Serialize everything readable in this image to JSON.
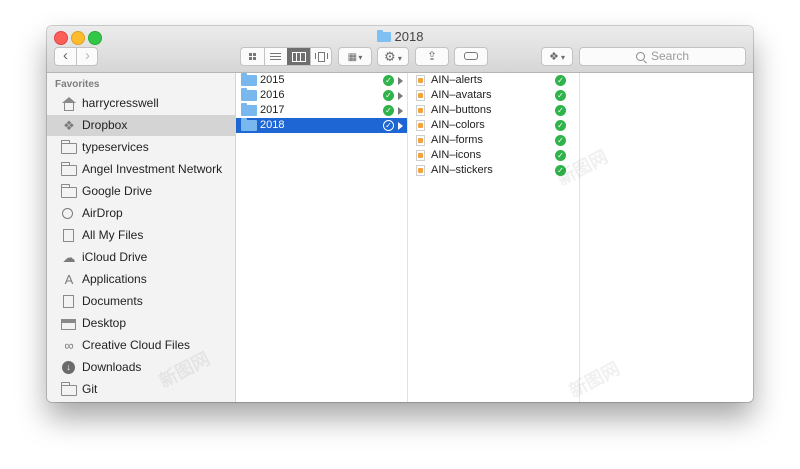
{
  "window": {
    "title": "2018"
  },
  "toolbar": {
    "back_glyph": "‹",
    "forward_glyph": "›",
    "search_placeholder": "Search",
    "view_modes": [
      "icon-view-icon",
      "list-view-icon",
      "column-view-icon",
      "cover-flow-icon"
    ]
  },
  "sidebar": {
    "header": "Favorites",
    "items": [
      {
        "label": "harrycresswell",
        "icon": "house-icon"
      },
      {
        "label": "Dropbox",
        "icon": "dropbox-icon"
      },
      {
        "label": "typeservices",
        "icon": "folder-icon"
      },
      {
        "label": "Angel Investment Network",
        "icon": "folder-icon"
      },
      {
        "label": "Google Drive",
        "icon": "folder-icon"
      },
      {
        "label": "AirDrop",
        "icon": "airdrop-icon"
      },
      {
        "label": "All My Files",
        "icon": "files-icon"
      },
      {
        "label": "iCloud Drive",
        "icon": "cloud-icon"
      },
      {
        "label": "Applications",
        "icon": "applications-icon"
      },
      {
        "label": "Documents",
        "icon": "documents-icon"
      },
      {
        "label": "Desktop",
        "icon": "desktop-icon"
      },
      {
        "label": "Creative Cloud Files",
        "icon": "creative-cloud-icon"
      },
      {
        "label": "Downloads",
        "icon": "download-icon"
      },
      {
        "label": "Git",
        "icon": "folder-icon"
      }
    ],
    "selected_index": 1
  },
  "columns": {
    "years": [
      {
        "name": "2015"
      },
      {
        "name": "2016"
      },
      {
        "name": "2017"
      },
      {
        "name": "2018"
      }
    ],
    "selected_year_index": 3,
    "files": [
      {
        "name": "AIN–alerts"
      },
      {
        "name": "AIN–avatars"
      },
      {
        "name": "AIN–buttons"
      },
      {
        "name": "AIN–colors"
      },
      {
        "name": "AIN–forms"
      },
      {
        "name": "AIN–icons"
      },
      {
        "name": "AIN–stickers"
      }
    ]
  },
  "colors": {
    "accent": "#1d66d4",
    "sync_ok": "#2fb34a",
    "folder": "#79b8ee"
  },
  "watermark": "新图网"
}
